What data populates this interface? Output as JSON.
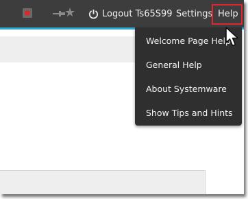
{
  "topbar": {
    "logout_label": "Logout Ts65S99",
    "settings_label": "Settings",
    "help_label": "Help",
    "icons": [
      "record-icon",
      "pin-icon",
      "star-icon",
      "power-icon"
    ],
    "accent_color": "#2aa6d6",
    "bar_color": "#3d3d3d",
    "highlight_color": "#e0262e"
  },
  "help_menu": {
    "items": [
      {
        "label": "Welcome Page Help"
      },
      {
        "label": "General Help"
      },
      {
        "label": "About Systemware"
      },
      {
        "label": "Show Tips and Hints"
      }
    ]
  }
}
